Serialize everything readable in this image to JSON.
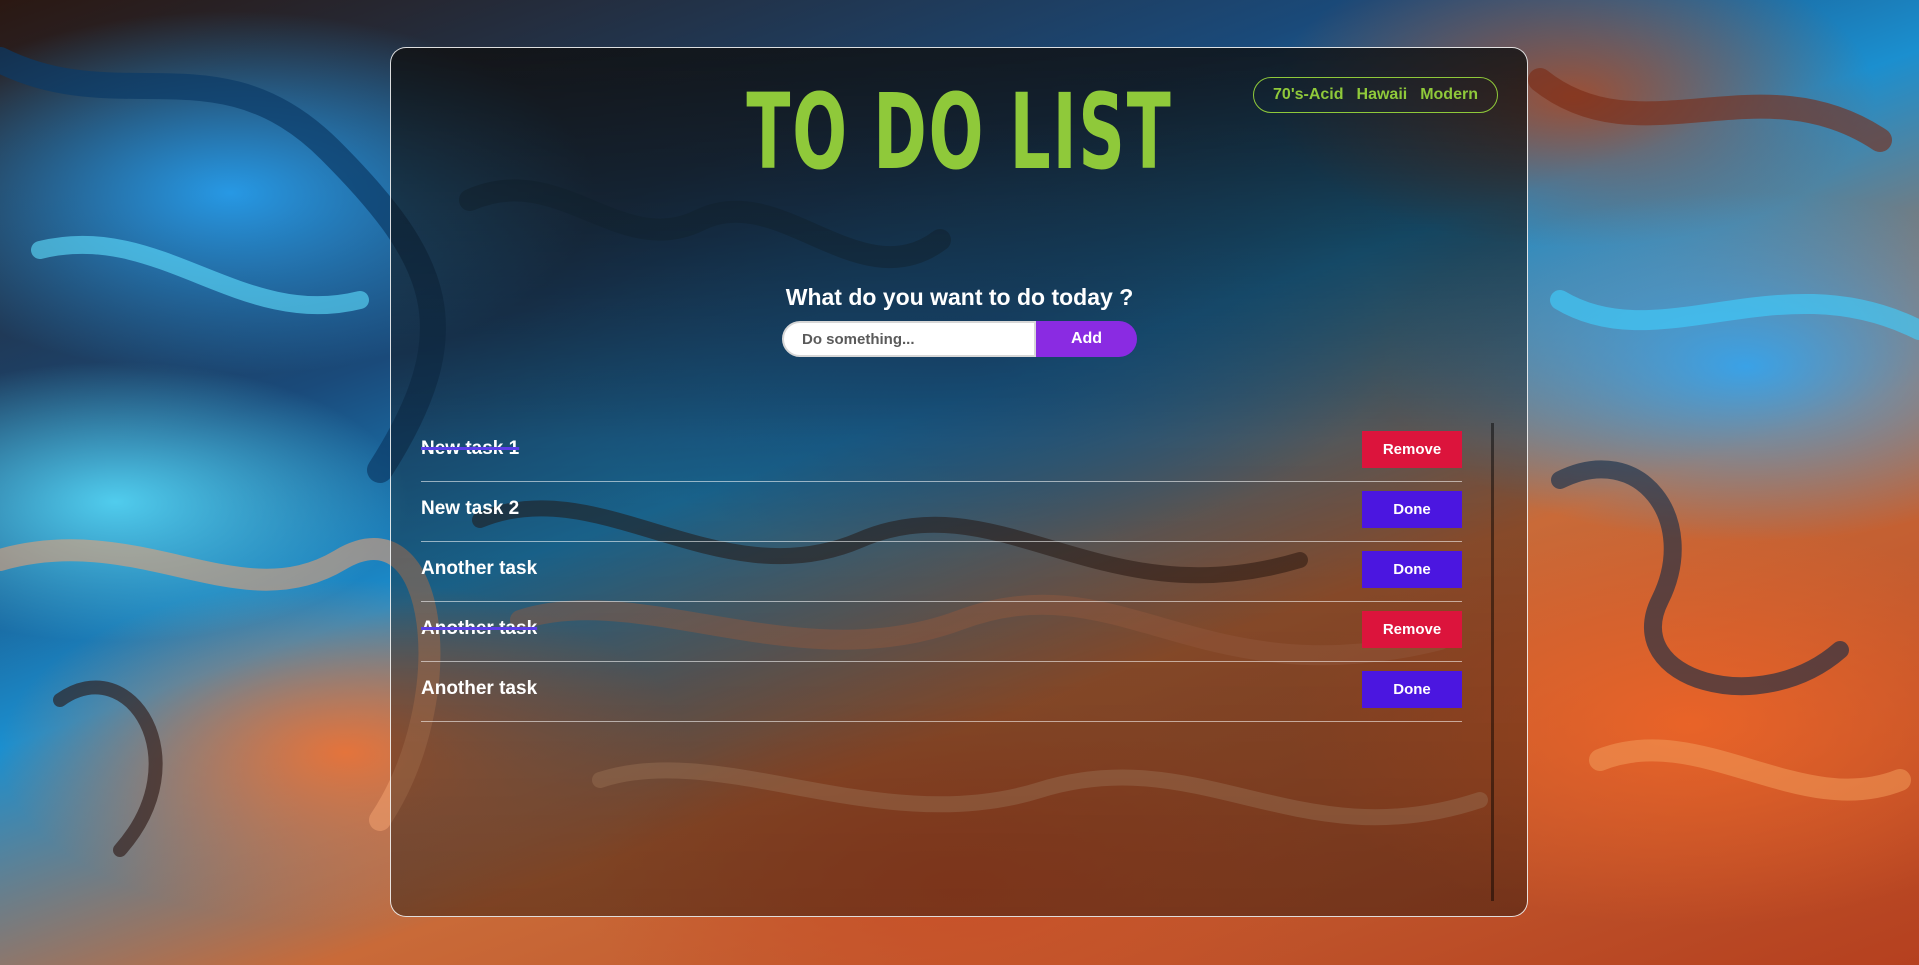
{
  "header": {
    "title": "TO DO LIST"
  },
  "themes": [
    "70's-Acid",
    "Hawaii",
    "Modern"
  ],
  "form": {
    "prompt": "What do you want to do today ?",
    "input_placeholder": "Do something...",
    "input_value": "",
    "add_label": "Add"
  },
  "colors": {
    "accent_green": "#8fc93a",
    "add_purple": "#8a2be2",
    "remove_red": "#dc143c",
    "done_indigo": "#4b16e0"
  },
  "tasks": [
    {
      "text": "New task 1",
      "completed": true,
      "action_label": "Remove"
    },
    {
      "text": "New task 2",
      "completed": false,
      "action_label": "Done"
    },
    {
      "text": "Another task",
      "completed": false,
      "action_label": "Done"
    },
    {
      "text": "Another task",
      "completed": true,
      "action_label": "Remove"
    },
    {
      "text": "Another task",
      "completed": false,
      "action_label": "Done"
    }
  ]
}
